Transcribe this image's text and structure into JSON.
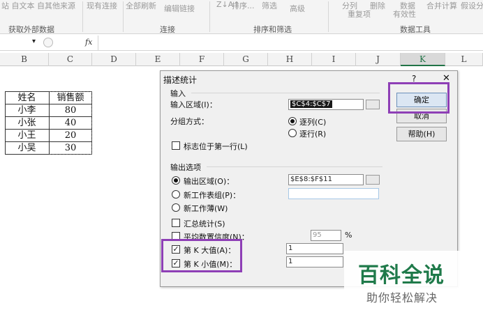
{
  "ribbon": {
    "items": [
      "站 自文本 自其他来源",
      "现有连接",
      "全部刷新",
      "编辑链接",
      "排序...",
      "筛选",
      "高级",
      "分列",
      "删除",
      "数据",
      "合并计算",
      "假设分",
      "重复项",
      "有效性"
    ],
    "groups": [
      "获取外部数据",
      "连接",
      "排序和筛选",
      "数据工具"
    ]
  },
  "formula_bar": {
    "fx": "fx",
    "dropdown": "▾"
  },
  "columns": [
    "B",
    "C",
    "D",
    "E",
    "F",
    "G",
    "H",
    "I",
    "J",
    "K",
    "L"
  ],
  "table": {
    "header": [
      "姓名",
      "销售额"
    ],
    "rows": [
      [
        "小李",
        "80"
      ],
      [
        "小张",
        "40"
      ],
      [
        "小王",
        "20"
      ],
      [
        "小吴",
        "30"
      ]
    ]
  },
  "dialog": {
    "title": "描述统计",
    "help": "?",
    "close": "✕",
    "input_section": "输入",
    "input_range_label": "输入区域(I)：",
    "input_range_value": "$C$4:$C$7",
    "group_by_label": "分组方式：",
    "by_column": "逐列(C)",
    "by_row": "逐行(R)",
    "labels_first_row": "标志位于第一行(L)",
    "output_section": "输出选项",
    "output_range": "输出区域(O)：",
    "output_range_value": "$E$8:$F$11",
    "new_sheet": "新工作表组(P)：",
    "new_workbook": "新工作薄(W)",
    "summary_stats": "汇总统计(S)",
    "confidence": "平均数置信度(N)：",
    "confidence_value": "95",
    "percent": "%",
    "kth_largest": "第 K 大值(A)：",
    "kth_largest_value": "1",
    "kth_smallest": "第 K 小值(M)：",
    "kth_smallest_value": "1",
    "ok": "确定",
    "cancel": "取消",
    "help_btn": "帮助(H)"
  },
  "watermark": {
    "title": "百科全说",
    "subtitle": "助你轻松解决"
  },
  "colors": {
    "highlight": "#8e3fb6",
    "watermark": "#1f7a4a",
    "selected_col": "#217346"
  }
}
